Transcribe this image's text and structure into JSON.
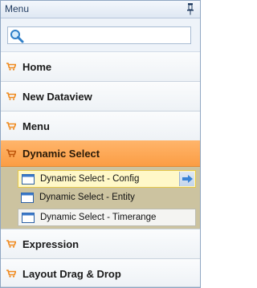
{
  "panel": {
    "title": "Menu",
    "pin_icon": "pin-icon"
  },
  "search": {
    "value": "",
    "placeholder": "",
    "icon": "search-icon"
  },
  "menu": {
    "items": [
      {
        "label": "Home",
        "icon": "cart-icon"
      },
      {
        "label": "New Dataview",
        "icon": "cart-icon"
      },
      {
        "label": "Menu",
        "icon": "cart-icon"
      },
      {
        "label": "Dynamic Select",
        "icon": "cart-icon",
        "active": true
      },
      {
        "label": "Expression",
        "icon": "cart-icon"
      },
      {
        "label": "Layout Drag & Drop",
        "icon": "cart-icon"
      }
    ],
    "subitems": [
      {
        "label": "Dynamic Select - Config",
        "icon": "window-icon",
        "state": "hover"
      },
      {
        "label": "Dynamic Select - Entity",
        "icon": "window-icon"
      },
      {
        "label": "Dynamic Select - Timerange",
        "icon": "window-icon",
        "state": "selected"
      }
    ]
  },
  "colors": {
    "accent": "#fb9d44",
    "border": "#8fa6c2",
    "submenu_bg": "#ccc3a0",
    "hover_bg": "#fff8c8",
    "cart": "#f08a1e"
  }
}
